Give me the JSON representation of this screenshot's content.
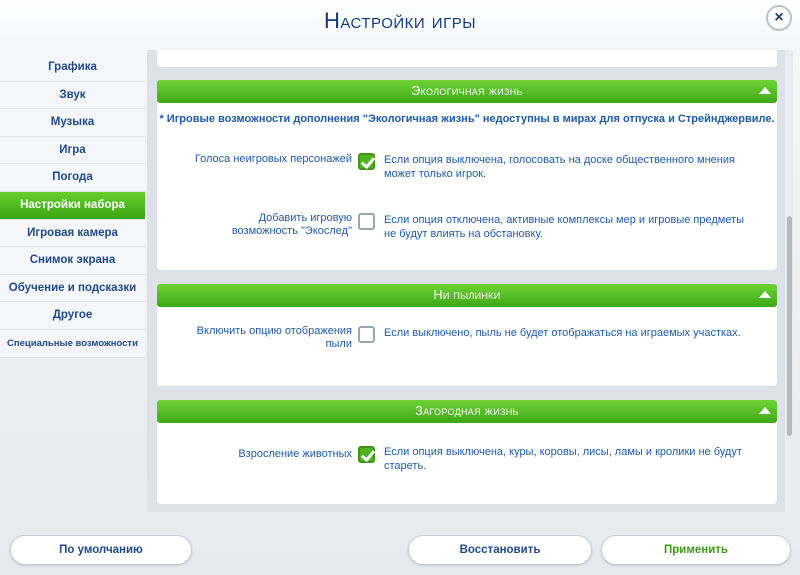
{
  "window": {
    "title": "Настройки игры",
    "close_icon": "×"
  },
  "sidebar": {
    "items": [
      {
        "label": "Графика",
        "active": false
      },
      {
        "label": "Звук",
        "active": false
      },
      {
        "label": "Музыка",
        "active": false
      },
      {
        "label": "Игра",
        "active": false
      },
      {
        "label": "Погода",
        "active": false
      },
      {
        "label": "Настройки набора",
        "active": true
      },
      {
        "label": "Игровая камера",
        "active": false
      },
      {
        "label": "Снимок экрана",
        "active": false
      },
      {
        "label": "Обучение и подсказки",
        "active": false
      },
      {
        "label": "Другое",
        "active": false
      },
      {
        "label": "Специальные возможности",
        "active": false
      }
    ]
  },
  "sections": [
    {
      "title": "Экологичная жизнь",
      "note": "* Игровые возможности дополнения \"Экологичная жизнь\" недоступны в мирах для отпуска и Стрейнджервиле.",
      "options": [
        {
          "label": "Голоса неигровых персонажей",
          "checked": true,
          "description": "Если опция выключена, голосовать на доске общественного мнения может только игрок."
        },
        {
          "label": "Добавить игровую возможность \"Экослед\"",
          "checked": false,
          "description": "Если опция отключена, активные комплексы мер и игровые предметы не будут влиять на обстановку."
        }
      ]
    },
    {
      "title": "Ни пылинки",
      "options": [
        {
          "label": "Включить опцию отображения пыли",
          "checked": false,
          "description": "Если выключено, пыль не будет отображаться на играемых участках."
        }
      ]
    },
    {
      "title": "Загородная жизнь",
      "options": [
        {
          "label": "Взросление животных",
          "checked": true,
          "description": "Если опция выключена, куры, коровы, лисы, ламы и кролики не будут стареть."
        }
      ]
    }
  ],
  "footer": {
    "default_label": "По умолчанию",
    "restore_label": "Восстановить",
    "apply_label": "Применить"
  },
  "colors": {
    "accent_green": "#4fb51f",
    "text_blue": "#1e5aa8",
    "title_navy": "#133a7a"
  },
  "icons": {
    "close": "close-icon",
    "collapse": "chevron-up-icon",
    "check": "checkmark-icon"
  }
}
